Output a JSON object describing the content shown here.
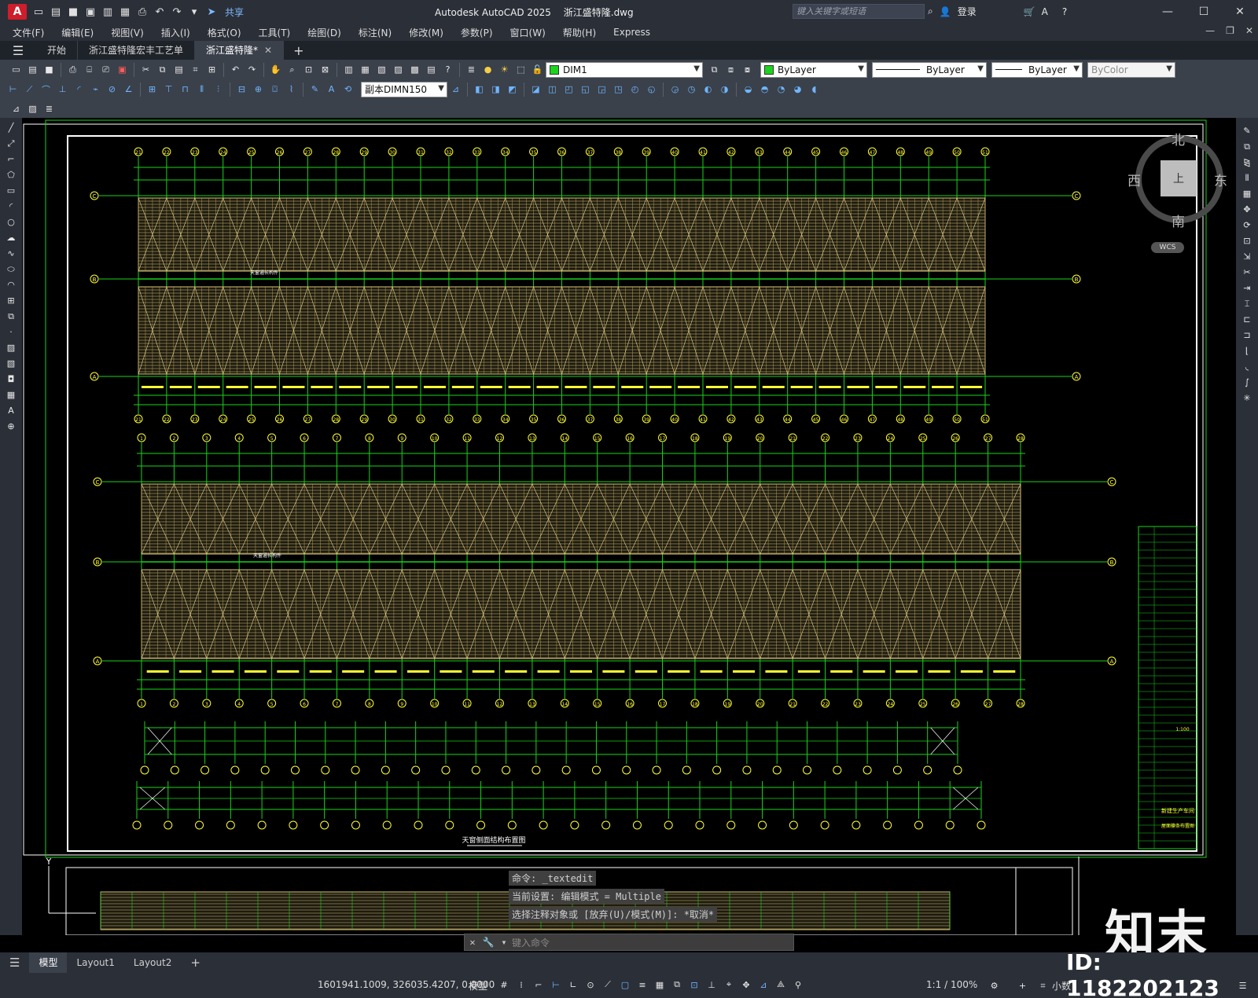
{
  "titlebar": {
    "app_logo": "A",
    "share_label": "共享",
    "app_name": "Autodesk AutoCAD 2025",
    "file_name": "浙江盛特隆.dwg",
    "search_placeholder": "键入关键字或短语",
    "login_label": "登录"
  },
  "menu": [
    "文件(F)",
    "编辑(E)",
    "视图(V)",
    "插入(I)",
    "格式(O)",
    "工具(T)",
    "绘图(D)",
    "标注(N)",
    "修改(M)",
    "参数(P)",
    "窗口(W)",
    "帮助(H)",
    "Express"
  ],
  "tabs": {
    "start": "开始",
    "doc1": "浙江盛特隆宏丰工艺单",
    "doc2": "浙江盛特隆*"
  },
  "toolbar": {
    "layer_name": "DIM1",
    "color": "ByLayer",
    "linetype": "ByLayer",
    "lineweight": "ByLayer",
    "plotstyle": "ByColor",
    "dimstyle": "副本DIMN150"
  },
  "viewcube": {
    "north": "北",
    "south": "南",
    "east": "东",
    "west": "西",
    "top": "上",
    "wcs": "WCS"
  },
  "drawing": {
    "title1": "天窗侧面结构布置图",
    "label_ridge": "天窗通长构件",
    "grid_top_numbers": [
      "21",
      "22",
      "23",
      "24",
      "25",
      "26",
      "27",
      "28",
      "29",
      "30",
      "31",
      "32",
      "33",
      "34",
      "35",
      "36",
      "37",
      "38",
      "39",
      "40",
      "41",
      "42",
      "43",
      "44",
      "45",
      "46",
      "47",
      "48",
      "49",
      "50",
      "51"
    ],
    "grid_mid_numbers": [
      "1",
      "2",
      "3",
      "4",
      "5",
      "6",
      "7",
      "8",
      "9",
      "10",
      "11",
      "12",
      "13",
      "14",
      "15",
      "16",
      "17",
      "18",
      "19",
      "20",
      "21",
      "22",
      "23",
      "24",
      "25",
      "26",
      "27",
      "28"
    ],
    "axis_letters": [
      "C",
      "B",
      "A"
    ],
    "titleblock_project": "新建生产车间",
    "titleblock_drawing": "屋面檩条布置图",
    "titleblock_scale": "1:100"
  },
  "command": {
    "line1": "命令: _textedit",
    "line2": "当前设置: 编辑模式 = Multiple",
    "line3": "选择注释对象或 [放弃(U)/模式(M)]: *取消*",
    "input_placeholder": "键入命令"
  },
  "watermark": {
    "brand": "知末",
    "id": "ID: 1182202123"
  },
  "layouts": [
    "模型",
    "Layout1",
    "Layout2"
  ],
  "status": {
    "coords": "1601941.1009, 326035.4207, 0.0000",
    "model": "模型",
    "scale": "1:1 / 100%",
    "units": "小数"
  },
  "colors": {
    "grid_green": "#19d319",
    "purlin_yellow": "#d9c27a",
    "dim_yellow": "#ffff33",
    "bg": "#000000",
    "chrome": "#2b3038"
  }
}
